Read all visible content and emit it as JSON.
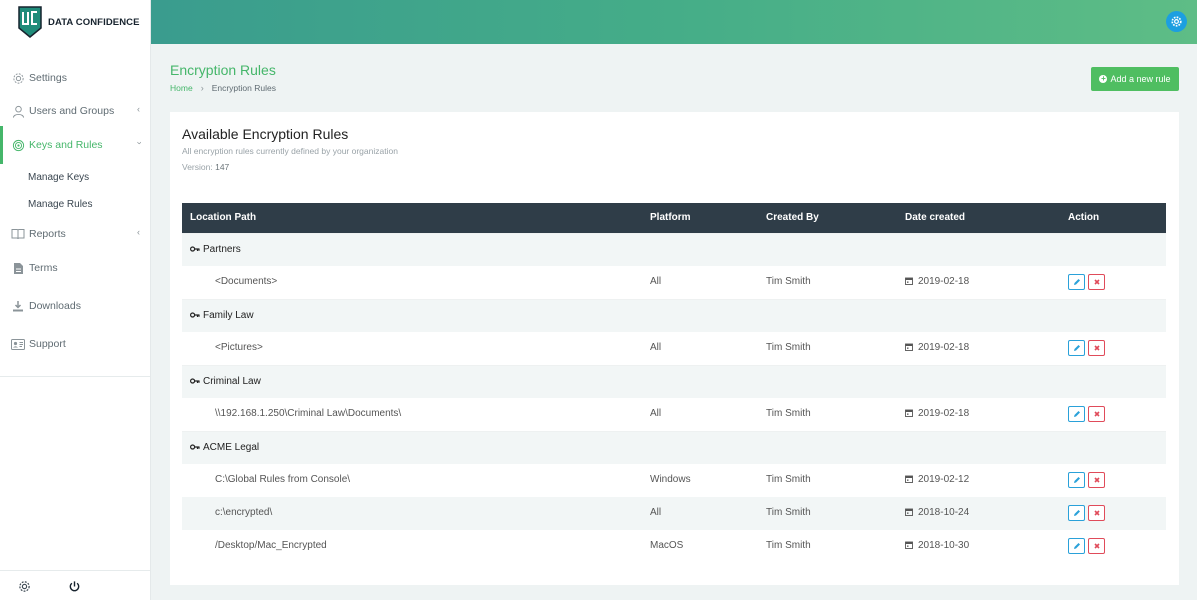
{
  "brand": {
    "name": "DATA CONFIDENCE"
  },
  "sidebar": {
    "items": [
      {
        "label": "Settings",
        "icon": "gear-icon"
      },
      {
        "label": "Users and Groups",
        "icon": "user-icon"
      },
      {
        "label": "Keys and Rules",
        "icon": "target-icon"
      },
      {
        "label": "Reports",
        "icon": "book-icon"
      },
      {
        "label": "Terms",
        "icon": "document-icon"
      },
      {
        "label": "Downloads",
        "icon": "download-icon"
      },
      {
        "label": "Support",
        "icon": "id-card-icon"
      }
    ],
    "subitems": [
      {
        "label": "Manage Keys"
      },
      {
        "label": "Manage Rules"
      }
    ]
  },
  "page": {
    "title": "Encryption Rules",
    "breadcrumb": {
      "home": "Home",
      "current": "Encryption Rules"
    },
    "add_button": "Add a new rule"
  },
  "card": {
    "title": "Available Encryption Rules",
    "subtitle": "All encryption rules currently defined by your organization",
    "version_label": "Version:",
    "version_value": "147"
  },
  "table": {
    "headers": [
      "Location Path",
      "Platform",
      "Created By",
      "Date created",
      "Action"
    ],
    "groups": [
      {
        "name": "Partners",
        "rows": [
          {
            "path": "<Documents>",
            "platform": "All",
            "created_by": "Tim Smith",
            "date": "2019-02-18"
          }
        ]
      },
      {
        "name": "Family Law",
        "rows": [
          {
            "path": "<Pictures>",
            "platform": "All",
            "created_by": "Tim Smith",
            "date": "2019-02-18"
          }
        ]
      },
      {
        "name": "Criminal Law",
        "rows": [
          {
            "path": "\\\\192.168.1.250\\Criminal Law\\Documents\\",
            "platform": "All",
            "created_by": "Tim Smith",
            "date": "2019-02-18"
          }
        ]
      },
      {
        "name": "ACME Legal",
        "rows": [
          {
            "path": "C:\\Global Rules from Console\\",
            "platform": "Windows",
            "created_by": "Tim Smith",
            "date": "2019-02-12"
          },
          {
            "path": "c:\\encrypted\\",
            "platform": "All",
            "created_by": "Tim Smith",
            "date": "2018-10-24"
          },
          {
            "path": "/Desktop/Mac_Encrypted",
            "platform": "MacOS",
            "created_by": "Tim Smith",
            "date": "2018-10-30"
          }
        ]
      }
    ]
  },
  "colors": {
    "accent": "#45b66a",
    "header_dark": "#2f3d48",
    "edit": "#2aa1d9",
    "delete": "#e04b5a"
  }
}
